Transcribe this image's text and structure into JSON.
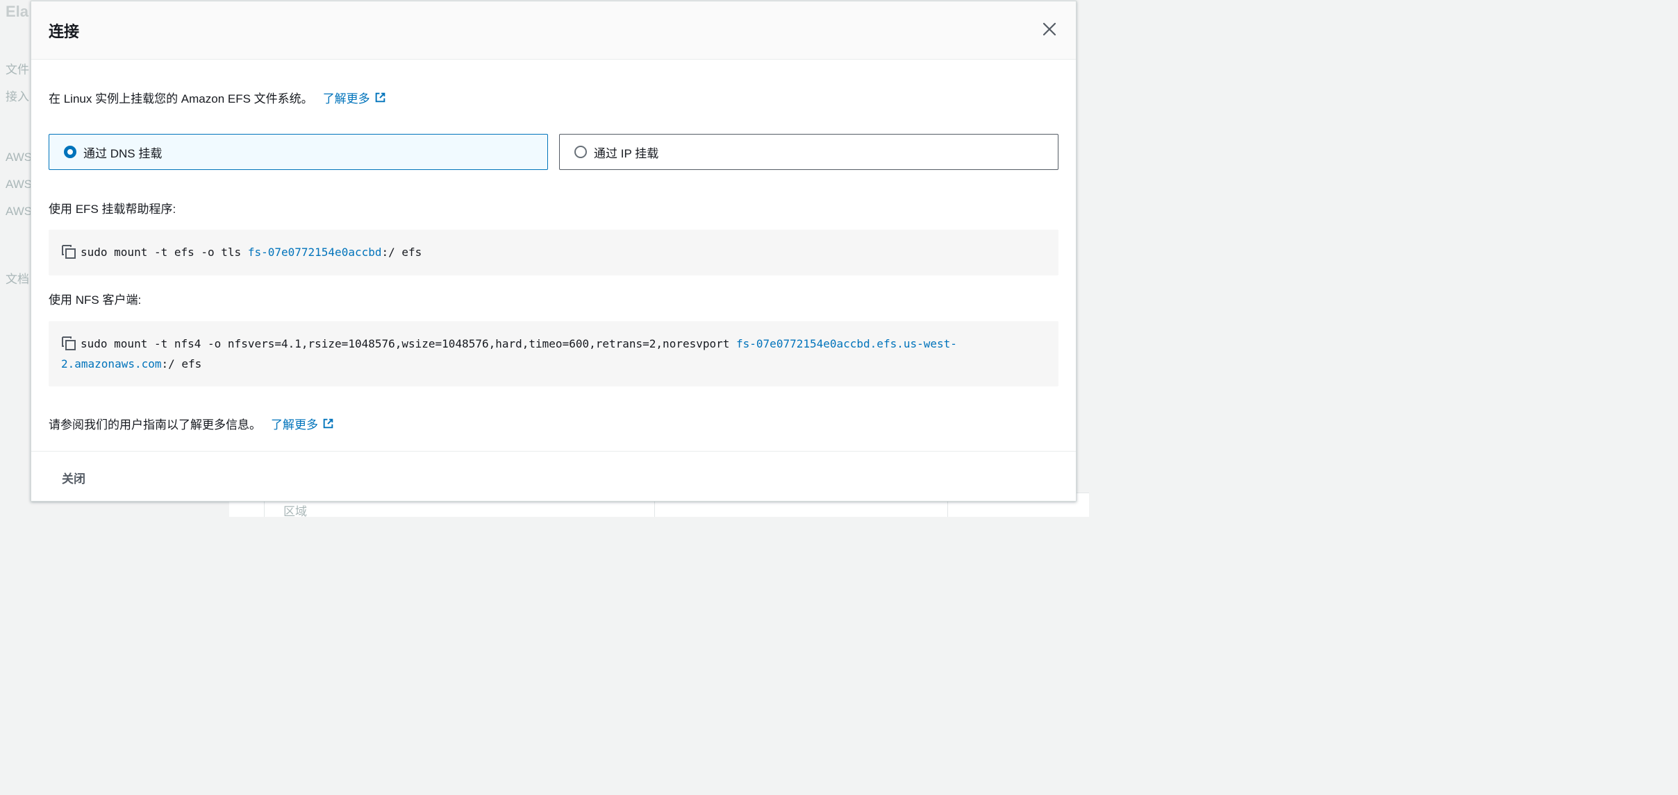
{
  "background": {
    "heading": "Ela",
    "items": [
      "文件",
      "接入",
      "AWS",
      "AWS",
      "AWS",
      "文档"
    ],
    "table_label": "区域"
  },
  "modal": {
    "title": "连接",
    "intro_text": "在 Linux 实例上挂载您的 Amazon EFS 文件系统。",
    "learn_more": "了解更多",
    "options": [
      {
        "label": "通过 DNS 挂载",
        "selected": true
      },
      {
        "label": "通过 IP 挂载",
        "selected": false
      }
    ],
    "efs_helper_label": "使用 EFS 挂载帮助程序:",
    "efs_command": {
      "prefix": "sudo mount -t efs -o tls ",
      "fs_id": "fs-07e0772154e0accbd",
      "suffix": ":/ efs"
    },
    "nfs_client_label": "使用 NFS 客户端:",
    "nfs_command": {
      "prefix": "sudo mount -t nfs4 -o nfsvers=4.1,rsize=1048576,wsize=1048576,hard,timeo=600,retrans=2,noresvport ",
      "dns_part1": "fs-07e0772154e0accbd.efs.us-west-",
      "dns_part2": "2.amazonaws.com",
      "suffix": ":/ efs"
    },
    "guide_text": "请参阅我们的用户指南以了解更多信息。",
    "guide_link": "了解更多",
    "close_button": "关闭"
  },
  "colors": {
    "accent": "#0073bb",
    "selected_tile_bg": "#f1faff",
    "code_bg": "#f6f6f6"
  },
  "icons": [
    "external-link-icon",
    "copy-icon",
    "close-icon"
  ]
}
